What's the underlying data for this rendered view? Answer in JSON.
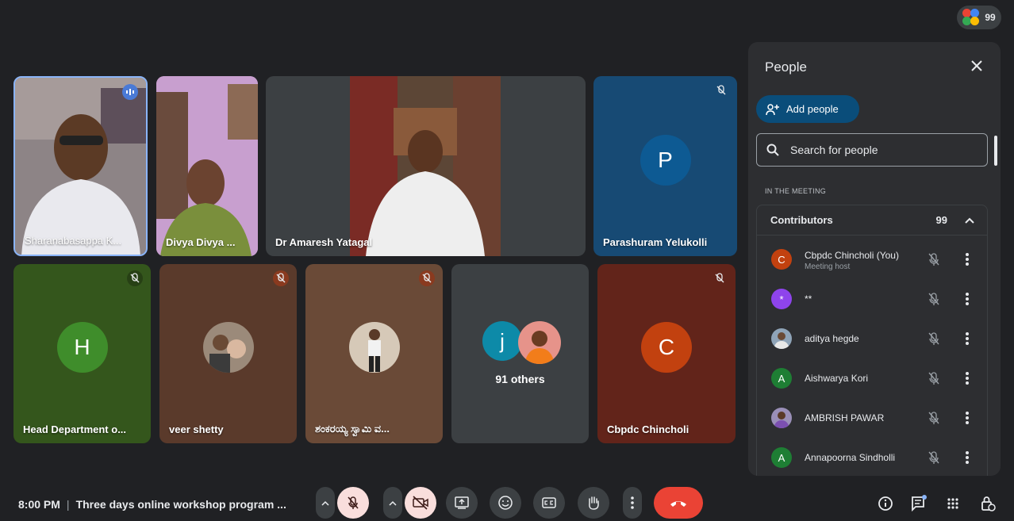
{
  "top_bar": {
    "participant_count": "99"
  },
  "tiles": [
    {
      "name": "Sharanabasappa K..."
    },
    {
      "name": "Divya Divya ..."
    },
    {
      "name": "Dr Amaresh Yatagal"
    },
    {
      "name": "Parashuram Yelukolli",
      "initial": "P",
      "color": "#0d5a93"
    },
    {
      "name": "Head Department o...",
      "initial": "H",
      "color": "#3f8d2b"
    },
    {
      "name": "veer shetty"
    },
    {
      "name": "ಶಂಕರಯ್ಯ ಸ್ವಾಮಿ ವ..."
    },
    {
      "name": "91 others",
      "initial": "j"
    },
    {
      "name": "Cbpdc Chincholi",
      "initial": "C",
      "color": "#c2410f"
    }
  ],
  "panel": {
    "title": "People",
    "add_label": "Add people",
    "search_placeholder": "Search for people",
    "section_label": "IN THE MEETING",
    "group_label": "Contributors",
    "group_count": "99",
    "participants": [
      {
        "name": "Cbpdc Chincholi (You)",
        "sub": "Meeting host",
        "initial": "C",
        "color": "#c2410f"
      },
      {
        "name": "**",
        "initial": "*",
        "color": "#8e44ec"
      },
      {
        "name": "aditya hegde",
        "initial": ""
      },
      {
        "name": "Aishwarya Kori",
        "initial": "A",
        "color": "#1e7e34"
      },
      {
        "name": "AMBRISH PAWAR",
        "initial": ""
      },
      {
        "name": "Annapoorna Sindholli",
        "initial": "A",
        "color": "#1e7e34"
      }
    ]
  },
  "bottom": {
    "time": "8:00 PM",
    "meeting_title": "Three days online workshop program ..."
  },
  "colors": {
    "end_call": "#ea4335",
    "muted_bg": "#f9dedc",
    "panel_bg": "#2d2e31",
    "accent": "#0a4d7a"
  }
}
